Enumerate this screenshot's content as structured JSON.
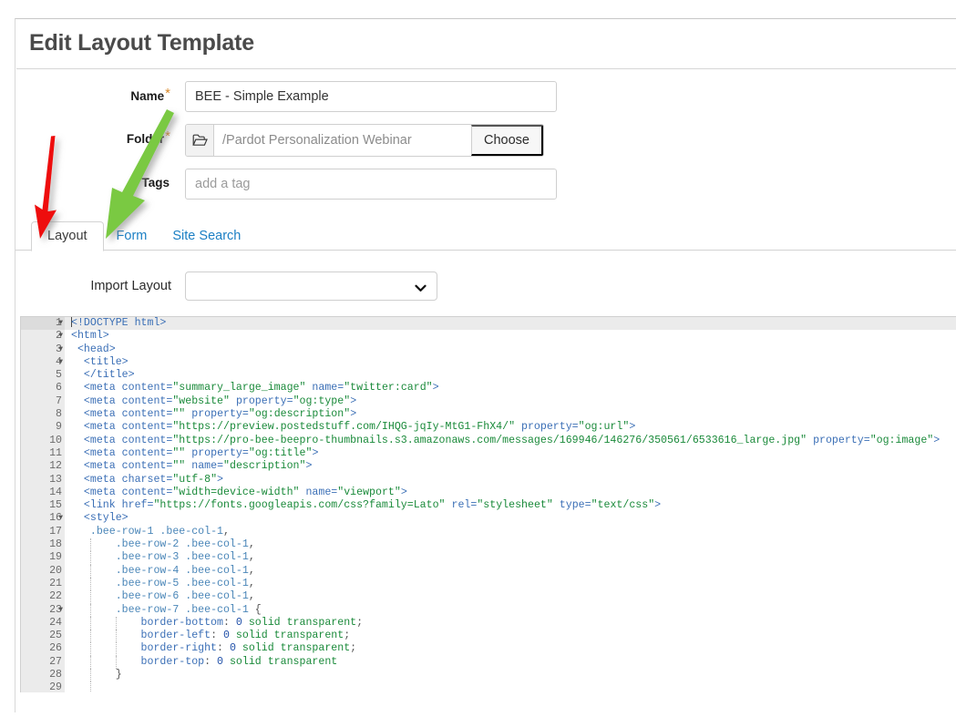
{
  "page": {
    "title": "Edit Layout Template"
  },
  "form": {
    "name": {
      "label": "Name",
      "required_marker": "*",
      "value": "BEE - Simple Example",
      "placeholder": ""
    },
    "folder": {
      "label": "Folder",
      "required_marker": "*",
      "value": "",
      "placeholder": "/Pardot Personalization Webinar",
      "icon": "folder-open-icon",
      "choose_label": "Choose"
    },
    "tags": {
      "label": "Tags",
      "value": "",
      "placeholder": "add a tag"
    }
  },
  "tabs": {
    "items": [
      {
        "label": "Layout",
        "active": true
      },
      {
        "label": "Form",
        "active": false
      },
      {
        "label": "Site Search",
        "active": false
      }
    ]
  },
  "import_layout": {
    "label": "Import Layout",
    "selected": "",
    "chevron": "chevron-down-icon"
  },
  "annotations": [
    {
      "name": "red-arrow",
      "color": "#ee1111",
      "points_at": "Layout"
    },
    {
      "name": "green-arrow",
      "color": "#7ac943",
      "points_at": "Form"
    }
  ],
  "editor": {
    "active_line": 1,
    "lines": [
      {
        "n": 1,
        "fold": true,
        "indent": 0,
        "caret": true,
        "tokens": [
          {
            "t": "tag",
            "v": "<!DOCTYPE html>"
          }
        ]
      },
      {
        "n": 2,
        "fold": true,
        "indent": 0,
        "tokens": [
          {
            "t": "tag",
            "v": "<html>"
          }
        ]
      },
      {
        "n": 3,
        "fold": true,
        "indent": 0,
        "tokens": [
          {
            "t": "plain",
            "v": " "
          },
          {
            "t": "tag",
            "v": "<head>"
          }
        ]
      },
      {
        "n": 4,
        "fold": true,
        "indent": 0,
        "tokens": [
          {
            "t": "plain",
            "v": "  "
          },
          {
            "t": "tag",
            "v": "<title>"
          }
        ]
      },
      {
        "n": 5,
        "fold": false,
        "indent": 0,
        "tokens": [
          {
            "t": "plain",
            "v": "  "
          },
          {
            "t": "tag",
            "v": "</title>"
          }
        ]
      },
      {
        "n": 6,
        "fold": false,
        "indent": 0,
        "tokens": [
          {
            "t": "plain",
            "v": "  "
          },
          {
            "t": "tag",
            "v": "<meta "
          },
          {
            "t": "attr",
            "v": "content="
          },
          {
            "t": "str",
            "v": "\"summary_large_image\""
          },
          {
            "t": "plain",
            "v": " "
          },
          {
            "t": "attr",
            "v": "name="
          },
          {
            "t": "str",
            "v": "\"twitter:card\""
          },
          {
            "t": "tag",
            "v": ">"
          }
        ]
      },
      {
        "n": 7,
        "fold": false,
        "indent": 0,
        "tokens": [
          {
            "t": "plain",
            "v": "  "
          },
          {
            "t": "tag",
            "v": "<meta "
          },
          {
            "t": "attr",
            "v": "content="
          },
          {
            "t": "str",
            "v": "\"website\""
          },
          {
            "t": "plain",
            "v": " "
          },
          {
            "t": "attr",
            "v": "property="
          },
          {
            "t": "str",
            "v": "\"og:type\""
          },
          {
            "t": "tag",
            "v": ">"
          }
        ]
      },
      {
        "n": 8,
        "fold": false,
        "indent": 0,
        "tokens": [
          {
            "t": "plain",
            "v": "  "
          },
          {
            "t": "tag",
            "v": "<meta "
          },
          {
            "t": "attr",
            "v": "content="
          },
          {
            "t": "str",
            "v": "\"\""
          },
          {
            "t": "plain",
            "v": " "
          },
          {
            "t": "attr",
            "v": "property="
          },
          {
            "t": "str",
            "v": "\"og:description\""
          },
          {
            "t": "tag",
            "v": ">"
          }
        ]
      },
      {
        "n": 9,
        "fold": false,
        "indent": 0,
        "tokens": [
          {
            "t": "plain",
            "v": "  "
          },
          {
            "t": "tag",
            "v": "<meta "
          },
          {
            "t": "attr",
            "v": "content="
          },
          {
            "t": "str",
            "v": "\"https://preview.postedstuff.com/IHQG-jqIy-MtG1-FhX4/\""
          },
          {
            "t": "plain",
            "v": " "
          },
          {
            "t": "attr",
            "v": "property="
          },
          {
            "t": "str",
            "v": "\"og:url\""
          },
          {
            "t": "tag",
            "v": ">"
          }
        ]
      },
      {
        "n": 10,
        "fold": false,
        "indent": 0,
        "tokens": [
          {
            "t": "plain",
            "v": "  "
          },
          {
            "t": "tag",
            "v": "<meta "
          },
          {
            "t": "attr",
            "v": "content="
          },
          {
            "t": "str",
            "v": "\"https://pro-bee-beepro-thumbnails.s3.amazonaws.com/messages/169946/146276/350561/6533616_large.jpg\""
          },
          {
            "t": "plain",
            "v": " "
          },
          {
            "t": "attr",
            "v": "property="
          },
          {
            "t": "str",
            "v": "\"og:image\""
          },
          {
            "t": "tag",
            "v": ">"
          }
        ]
      },
      {
        "n": 11,
        "fold": false,
        "indent": 0,
        "tokens": [
          {
            "t": "plain",
            "v": "  "
          },
          {
            "t": "tag",
            "v": "<meta "
          },
          {
            "t": "attr",
            "v": "content="
          },
          {
            "t": "str",
            "v": "\"\""
          },
          {
            "t": "plain",
            "v": " "
          },
          {
            "t": "attr",
            "v": "property="
          },
          {
            "t": "str",
            "v": "\"og:title\""
          },
          {
            "t": "tag",
            "v": ">"
          }
        ]
      },
      {
        "n": 12,
        "fold": false,
        "indent": 0,
        "tokens": [
          {
            "t": "plain",
            "v": "  "
          },
          {
            "t": "tag",
            "v": "<meta "
          },
          {
            "t": "attr",
            "v": "content="
          },
          {
            "t": "str",
            "v": "\"\""
          },
          {
            "t": "plain",
            "v": " "
          },
          {
            "t": "attr",
            "v": "name="
          },
          {
            "t": "str",
            "v": "\"description\""
          },
          {
            "t": "tag",
            "v": ">"
          }
        ]
      },
      {
        "n": 13,
        "fold": false,
        "indent": 0,
        "tokens": [
          {
            "t": "plain",
            "v": "  "
          },
          {
            "t": "tag",
            "v": "<meta "
          },
          {
            "t": "attr",
            "v": "charset="
          },
          {
            "t": "str",
            "v": "\"utf-8\""
          },
          {
            "t": "tag",
            "v": ">"
          }
        ]
      },
      {
        "n": 14,
        "fold": false,
        "indent": 0,
        "tokens": [
          {
            "t": "plain",
            "v": "  "
          },
          {
            "t": "tag",
            "v": "<meta "
          },
          {
            "t": "attr",
            "v": "content="
          },
          {
            "t": "str",
            "v": "\"width=device-width\""
          },
          {
            "t": "plain",
            "v": " "
          },
          {
            "t": "attr",
            "v": "name="
          },
          {
            "t": "str",
            "v": "\"viewport\""
          },
          {
            "t": "tag",
            "v": ">"
          }
        ]
      },
      {
        "n": 15,
        "fold": false,
        "indent": 0,
        "tokens": [
          {
            "t": "plain",
            "v": "  "
          },
          {
            "t": "tag",
            "v": "<link "
          },
          {
            "t": "attr",
            "v": "href="
          },
          {
            "t": "str",
            "v": "\"https://fonts.googleapis.com/css?family=Lato\""
          },
          {
            "t": "plain",
            "v": " "
          },
          {
            "t": "attr",
            "v": "rel="
          },
          {
            "t": "str",
            "v": "\"stylesheet\""
          },
          {
            "t": "plain",
            "v": " "
          },
          {
            "t": "attr",
            "v": "type="
          },
          {
            "t": "str",
            "v": "\"text/css\""
          },
          {
            "t": "tag",
            "v": ">"
          }
        ]
      },
      {
        "n": 16,
        "fold": true,
        "indent": 0,
        "tokens": [
          {
            "t": "plain",
            "v": "  "
          },
          {
            "t": "tag",
            "v": "<style>"
          }
        ]
      },
      {
        "n": 17,
        "fold": false,
        "indent": 0,
        "tokens": [
          {
            "t": "plain",
            "v": "   "
          },
          {
            "t": "sel",
            "v": ".bee-row-1 .bee-col-1"
          },
          {
            "t": "punc",
            "v": ","
          }
        ]
      },
      {
        "n": 18,
        "fold": false,
        "indent": 1,
        "tokens": [
          {
            "t": "plain",
            "v": "       "
          },
          {
            "t": "sel",
            "v": ".bee-row-2 .bee-col-1"
          },
          {
            "t": "punc",
            "v": ","
          }
        ]
      },
      {
        "n": 19,
        "fold": false,
        "indent": 1,
        "tokens": [
          {
            "t": "plain",
            "v": "       "
          },
          {
            "t": "sel",
            "v": ".bee-row-3 .bee-col-1"
          },
          {
            "t": "punc",
            "v": ","
          }
        ]
      },
      {
        "n": 20,
        "fold": false,
        "indent": 1,
        "tokens": [
          {
            "t": "plain",
            "v": "       "
          },
          {
            "t": "sel",
            "v": ".bee-row-4 .bee-col-1"
          },
          {
            "t": "punc",
            "v": ","
          }
        ]
      },
      {
        "n": 21,
        "fold": false,
        "indent": 1,
        "tokens": [
          {
            "t": "plain",
            "v": "       "
          },
          {
            "t": "sel",
            "v": ".bee-row-5 .bee-col-1"
          },
          {
            "t": "punc",
            "v": ","
          }
        ]
      },
      {
        "n": 22,
        "fold": false,
        "indent": 1,
        "tokens": [
          {
            "t": "plain",
            "v": "       "
          },
          {
            "t": "sel",
            "v": ".bee-row-6 .bee-col-1"
          },
          {
            "t": "punc",
            "v": ","
          }
        ]
      },
      {
        "n": 23,
        "fold": true,
        "indent": 1,
        "tokens": [
          {
            "t": "plain",
            "v": "       "
          },
          {
            "t": "sel",
            "v": ".bee-row-7 .bee-col-1"
          },
          {
            "t": "punc",
            "v": " {"
          }
        ]
      },
      {
        "n": 24,
        "fold": false,
        "indent": 2,
        "tokens": [
          {
            "t": "plain",
            "v": "           "
          },
          {
            "t": "prop",
            "v": "border-bottom"
          },
          {
            "t": "punc",
            "v": ": "
          },
          {
            "t": "num",
            "v": "0"
          },
          {
            "t": "plain",
            "v": " "
          },
          {
            "t": "str",
            "v": "solid transparent"
          },
          {
            "t": "punc",
            "v": ";"
          }
        ]
      },
      {
        "n": 25,
        "fold": false,
        "indent": 2,
        "tokens": [
          {
            "t": "plain",
            "v": "           "
          },
          {
            "t": "prop",
            "v": "border-left"
          },
          {
            "t": "punc",
            "v": ": "
          },
          {
            "t": "num",
            "v": "0"
          },
          {
            "t": "plain",
            "v": " "
          },
          {
            "t": "str",
            "v": "solid transparent"
          },
          {
            "t": "punc",
            "v": ";"
          }
        ]
      },
      {
        "n": 26,
        "fold": false,
        "indent": 2,
        "tokens": [
          {
            "t": "plain",
            "v": "           "
          },
          {
            "t": "prop",
            "v": "border-right"
          },
          {
            "t": "punc",
            "v": ": "
          },
          {
            "t": "num",
            "v": "0"
          },
          {
            "t": "plain",
            "v": " "
          },
          {
            "t": "str",
            "v": "solid transparent"
          },
          {
            "t": "punc",
            "v": ";"
          }
        ]
      },
      {
        "n": 27,
        "fold": false,
        "indent": 2,
        "tokens": [
          {
            "t": "plain",
            "v": "           "
          },
          {
            "t": "prop",
            "v": "border-top"
          },
          {
            "t": "punc",
            "v": ": "
          },
          {
            "t": "num",
            "v": "0"
          },
          {
            "t": "plain",
            "v": " "
          },
          {
            "t": "str",
            "v": "solid transparent"
          }
        ]
      },
      {
        "n": 28,
        "fold": false,
        "indent": 1,
        "tokens": [
          {
            "t": "plain",
            "v": "       "
          },
          {
            "t": "punc",
            "v": "}"
          }
        ]
      },
      {
        "n": 29,
        "fold": false,
        "indent": 1,
        "tokens": [
          {
            "t": "plain",
            "v": ""
          }
        ]
      }
    ]
  }
}
